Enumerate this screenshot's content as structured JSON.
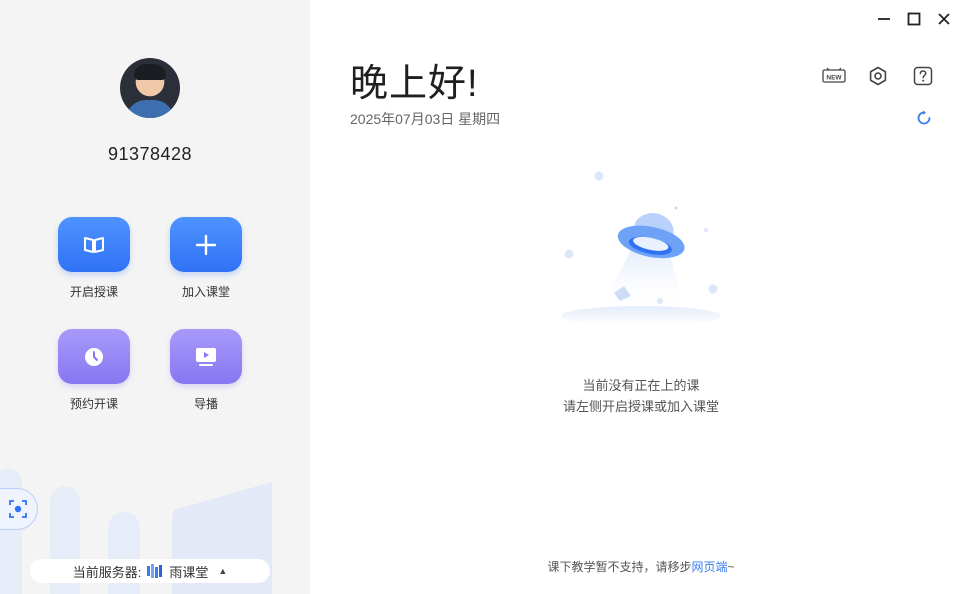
{
  "user": {
    "id": "91378428"
  },
  "actions": [
    {
      "label": "开启授课",
      "icon": "book-icon"
    },
    {
      "label": "加入课堂",
      "icon": "plus-icon"
    },
    {
      "label": "预约开课",
      "icon": "clock-icon"
    },
    {
      "label": "导播",
      "icon": "monitor-icon"
    }
  ],
  "server": {
    "prefix": "当前服务器:",
    "name": "雨课堂"
  },
  "main": {
    "greeting": "晚上好!",
    "date": "2025年07月03日 星期四",
    "empty_line1": "当前没有正在上的课",
    "empty_line2": "请左侧开启授课或加入课堂",
    "footer_text": "课下教学暂不支持，请移步",
    "footer_link": "网页端",
    "footer_suffix": "~"
  },
  "toolbar": {
    "new_badge": "NEW"
  },
  "colors": {
    "accent": "#2f72f5",
    "purple": "#8677f2",
    "link": "#3a7cf0"
  }
}
